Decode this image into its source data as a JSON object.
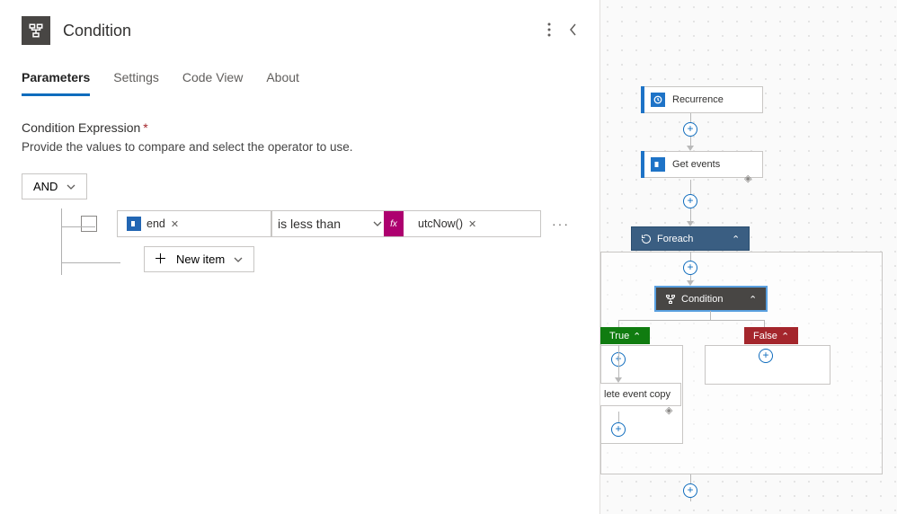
{
  "header": {
    "title": "Condition"
  },
  "tabs": [
    "Parameters",
    "Settings",
    "Code View",
    "About"
  ],
  "activeTab": "Parameters",
  "section": {
    "label": "Condition Expression",
    "description": "Provide the values to compare and select the operator to use."
  },
  "group": {
    "operator": "AND",
    "newItemLabel": "New item"
  },
  "row": {
    "leftToken": "end",
    "operator": "is less than",
    "rightToken": "utcNow()"
  },
  "canvas": {
    "recurrence": "Recurrence",
    "getEvents": "Get events",
    "foreach": "Foreach",
    "condition": "Condition",
    "trueLabel": "True",
    "falseLabel": "False",
    "deleteEvent": "lete event copy"
  }
}
